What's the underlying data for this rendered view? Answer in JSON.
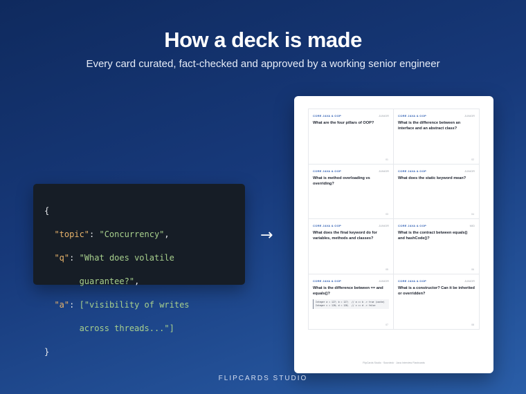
{
  "header": {
    "title": "How a deck is made",
    "subtitle": "Every card curated, fact-checked and approved by a working senior engineer"
  },
  "code_sample": {
    "open_brace": "{",
    "close_brace": "}",
    "topic_key": "\"topic\"",
    "topic_value": "\"Concurrency\"",
    "q_key": "\"q\"",
    "q_value_line1": "\"What does volatile",
    "q_value_line2": "guarantee?\"",
    "a_key": "\"a\"",
    "a_value_line1": "[\"visibility of writes",
    "a_value_line2": "across threads...\"]"
  },
  "arrow": "→",
  "deck_page": {
    "cards": [
      {
        "topic": "CORE JAVA & OOP",
        "level": "JUNIOR",
        "question": "What are the four pillars of OOP?",
        "number": "01"
      },
      {
        "topic": "CORE JAVA & OOP",
        "level": "JUNIOR",
        "question": "What is the difference between an interface and an abstract class?",
        "number": "02"
      },
      {
        "topic": "CORE JAVA & OOP",
        "level": "JUNIOR",
        "question": "What is method overloading vs overriding?",
        "number": "03"
      },
      {
        "topic": "CORE JAVA & OOP",
        "level": "JUNIOR",
        "question": "What does the static keyword mean?",
        "number": "04"
      },
      {
        "topic": "CORE JAVA & OOP",
        "level": "JUNIOR",
        "question": "What does the final keyword do for variables, methods and classes?",
        "number": "05"
      },
      {
        "topic": "CORE JAVA & OOP",
        "level": "MID",
        "question": "What is the contract between equals() and hashCode()?",
        "number": "06"
      },
      {
        "topic": "CORE JAVA & OOP",
        "level": "JUNIOR",
        "question": "What is the difference between == and equals()?",
        "number": "07",
        "code_line1": "Integer a = 127; b = 127;  // a == b -> true (cache)",
        "code_line2": "Integer c = 128; d = 128;  // c == d -> false"
      },
      {
        "topic": "CORE JAVA & OOP",
        "level": "JUNIOR",
        "question": "What is a constructor? Can it be inherited or overridden?",
        "number": "08"
      }
    ],
    "footer": "FlipCards Studio · Sourdeck · Java Interview Flashcards"
  },
  "brand": "FLIPCARDS STUDIO",
  "colors": {
    "background_top": "#0f2a5e",
    "background_bottom": "#2a5ea8",
    "code_panel": "#161d26",
    "code_key": "#e8b36a",
    "code_string": "#a8d08d",
    "card_topic": "#2f5fb3"
  }
}
